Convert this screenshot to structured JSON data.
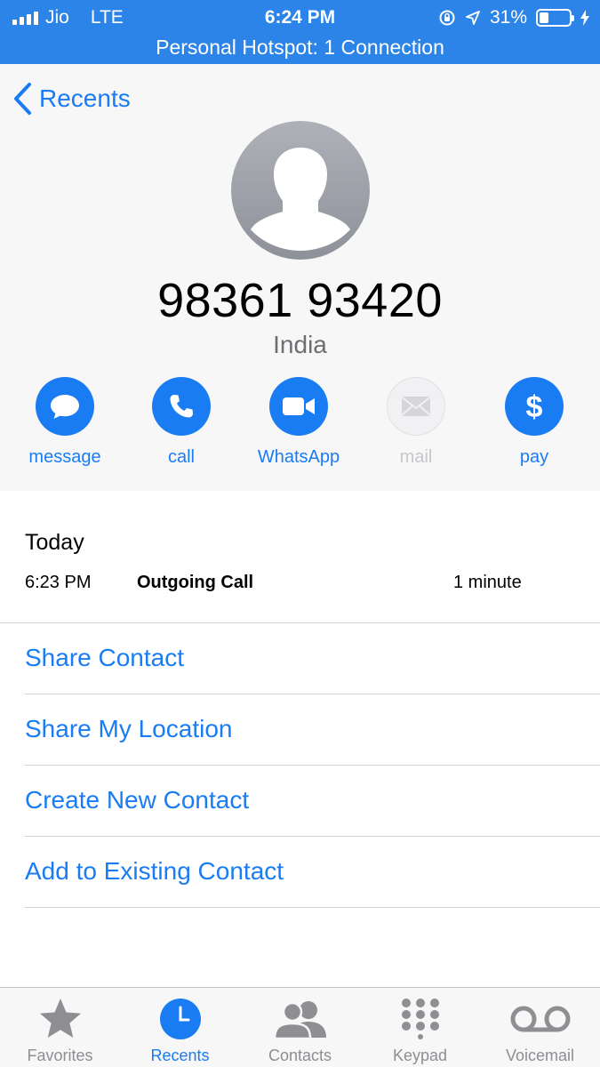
{
  "status": {
    "carrier": "Jio",
    "network": "LTE",
    "time": "6:24 PM",
    "battery": "31%",
    "battery_level": 0.31,
    "hotspot": "Personal Hotspot: 1 Connection"
  },
  "nav": {
    "back_label": "Recents"
  },
  "contact": {
    "number": "98361 93420",
    "country": "India"
  },
  "actions": [
    {
      "label": "message",
      "icon": "message-bubble-icon",
      "enabled": true
    },
    {
      "label": "call",
      "icon": "phone-icon",
      "enabled": true
    },
    {
      "label": "WhatsApp",
      "icon": "video-camera-icon",
      "enabled": true
    },
    {
      "label": "mail",
      "icon": "envelope-icon",
      "enabled": false
    },
    {
      "label": "pay",
      "icon": "dollar-icon",
      "enabled": true
    }
  ],
  "history": {
    "day": "Today",
    "calls": [
      {
        "time": "6:23 PM",
        "type": "Outgoing Call",
        "duration": "1 minute"
      }
    ]
  },
  "links": [
    "Share Contact",
    "Share My Location",
    "Create New Contact",
    "Add to Existing Contact"
  ],
  "tabs": [
    {
      "label": "Favorites",
      "icon": "star-icon",
      "active": false
    },
    {
      "label": "Recents",
      "icon": "clock-icon",
      "active": true
    },
    {
      "label": "Contacts",
      "icon": "contacts-icon",
      "active": false
    },
    {
      "label": "Keypad",
      "icon": "keypad-icon",
      "active": false
    },
    {
      "label": "Voicemail",
      "icon": "voicemail-icon",
      "active": false
    }
  ],
  "colors": {
    "accent": "#1a7cf2",
    "statusbar": "#2c83e8",
    "inactive": "#8e8e93"
  }
}
